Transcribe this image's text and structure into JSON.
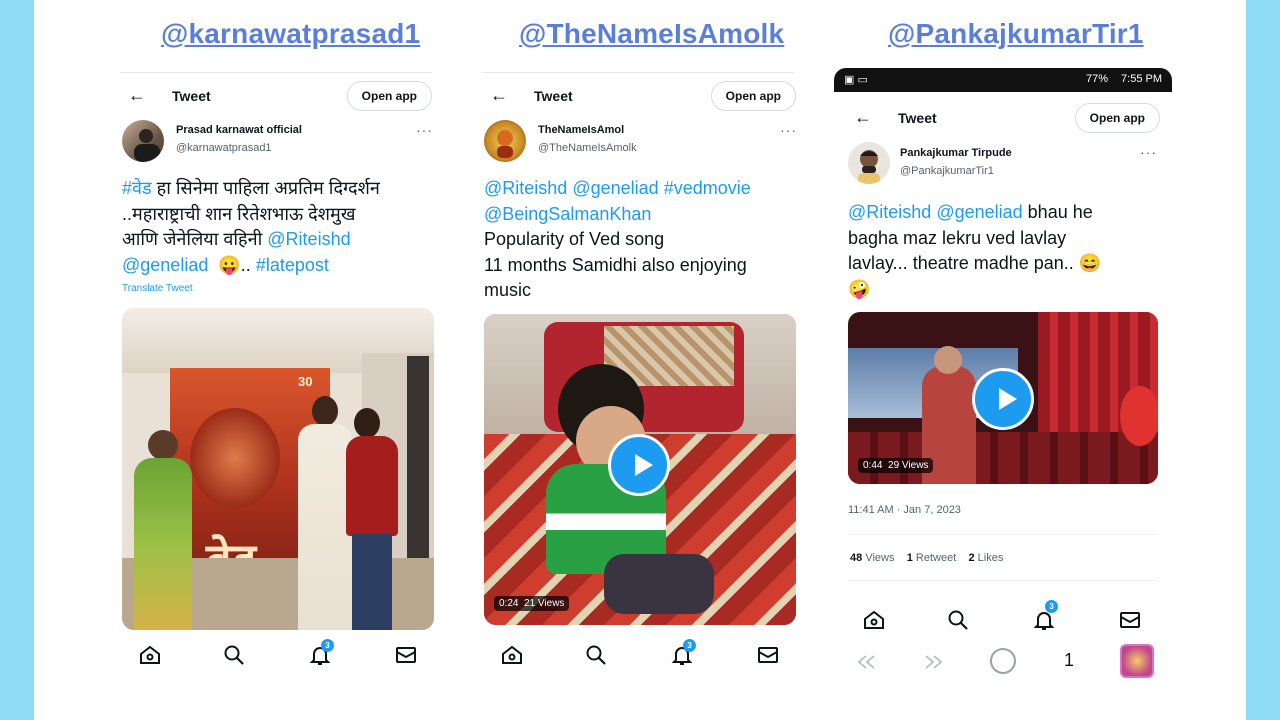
{
  "handles": [
    "@karnawatprasad1",
    "@TheNameIsAmolk",
    "@PankajkumarTir1"
  ],
  "colors": {
    "side_bar": "#8fdcf8",
    "handle": "#5b7fd9",
    "accent": "#1d9bf0"
  },
  "common": {
    "tweet_label": "Tweet",
    "open_app_label": "Open app",
    "back_icon": "arrow-left-icon",
    "more_label": "···"
  },
  "tweet1": {
    "author_name": "Prasad karnawat official",
    "author_handle": "@karnawatprasad1",
    "hashtag_ved": "#वेड",
    "text_line1": " हा सिनेमा पाहिला अप्रतिम दिग्दर्शन",
    "text_line2": "..महाराष्ट्राची शान रितेशभाऊ देशमुख",
    "text_line3": "आणि जेनेलिया वहिनी ",
    "mention_riteish": "@Riteishd",
    "mention_genelia": "@geneliad",
    "emoji": "😛",
    "dots": "..",
    "hashtag_latepost": "#latepost",
    "translate": "Translate Tweet",
    "poster_year": "30",
    "poster_title": "वेड"
  },
  "tweet2": {
    "mentions_line1_a": "@Riteishd",
    "mentions_line1_b": "@geneliad",
    "mentions_line1_c": "#vedmovie",
    "mention_salman": "@BeingSalmanKhan",
    "author_name": "TheNameIsAmol",
    "author_handle": "@TheNameIsAmolk",
    "text_line3": "Popularity of Ved song",
    "text_line4": "11 months  Samidhi also enjoying",
    "text_line5": "music",
    "duration": "0:24",
    "views": "21 Views"
  },
  "tweet3": {
    "status_time": "7:55 PM",
    "status_battery": "77%",
    "author_name": "Pankajkumar Tirpude",
    "author_handle": "@PankajkumarTir1",
    "mention_riteish": "@Riteishd",
    "mention_genelia": "@geneliad",
    "text_a": " bhau he",
    "text_line2": "bagha maz lekru ved lavlay",
    "text_line3": "lavlay... theatre madhe pan.. ",
    "emoji_grin": "😄",
    "emoji_crazy": "🤪",
    "duration": "0:44",
    "views": "29 Views",
    "timestamp": "11:41 AM · Jan 7, 2023",
    "views_count": "48",
    "views_label": "Views",
    "retweet_count": "1",
    "retweet_label": "Retweet",
    "likes_count": "2",
    "likes_label": "Likes",
    "tab_count": "1"
  },
  "nav": {
    "badge_count": "3",
    "icons": [
      "home-icon",
      "search-icon",
      "bell-icon",
      "mail-icon"
    ]
  }
}
